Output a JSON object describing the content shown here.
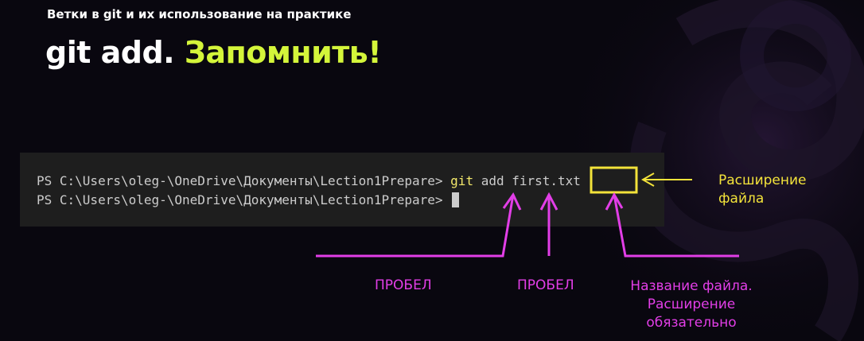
{
  "slide": {
    "subtitle": "Ветки в git и их использование на практике",
    "title_main": "git add.",
    "title_accent": "Запомнить!"
  },
  "terminal": {
    "line1_prompt": "PS C:\\Users\\oleg-\\OneDrive\\Документы\\Lection1Prepare> ",
    "line1_cmd": "git",
    "line1_args": " add first.txt",
    "line2_prompt": "PS C:\\Users\\oleg-\\OneDrive\\Документы\\Lection1Prepare> "
  },
  "annotations": {
    "extension_line1": "Расширение",
    "extension_line2": "файла",
    "space1": "ПРОБЕЛ",
    "space2": "ПРОБЕЛ",
    "filename_line1": "Название файла.",
    "filename_line2": "Расширение",
    "filename_line3": "обязательно"
  },
  "colors": {
    "accent_lime": "#d4f53a",
    "annotation_pink": "#e23ee7",
    "annotation_yellow": "#f3e33a",
    "terminal_bg": "#1e1e1e"
  }
}
